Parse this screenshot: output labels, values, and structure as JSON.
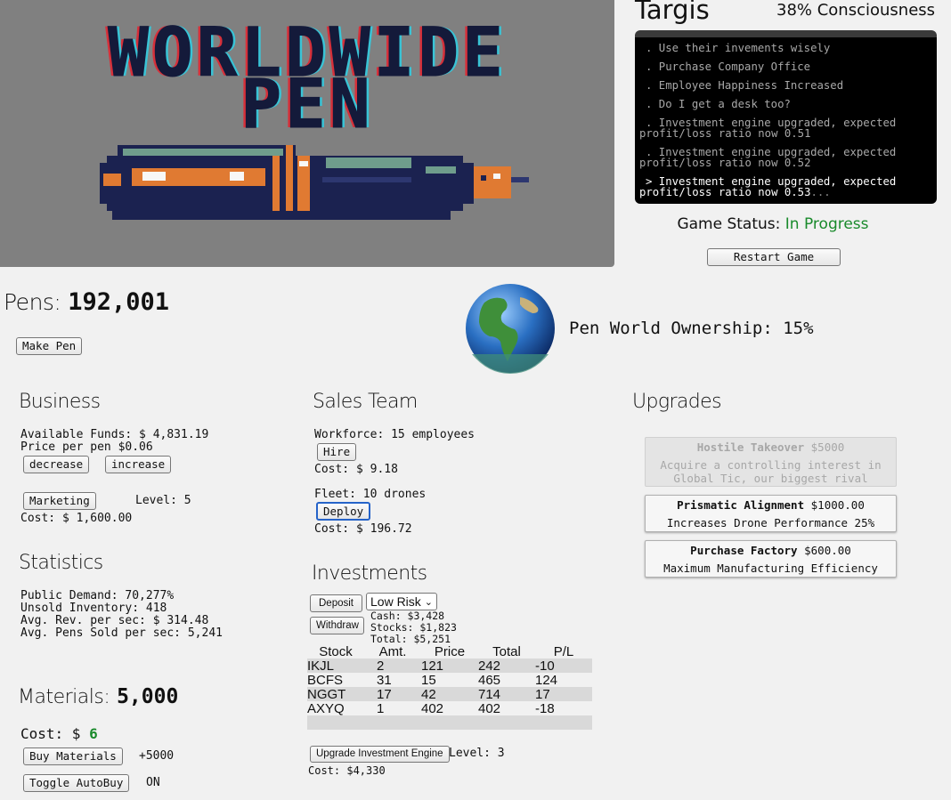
{
  "banner": {
    "line1": "WORLDWIDE",
    "line2": "PEN"
  },
  "console": {
    "title": "Targis",
    "consciousness": "38% Consciousness",
    "logs": [
      ". Use their invements wisely",
      ". Purchase Company Office",
      ". Employee Happiness Increased",
      ". Do I get a desk too?",
      ". Investment engine upgraded, expected profit/loss ratio now 0.51",
      ". Investment engine upgraded, expected profit/loss ratio now 0.52",
      "> Investment engine upgraded, expected profit/loss ratio now 0.53"
    ],
    "cursor": "...",
    "status_label": "Game Status:",
    "status_value": "In Progress",
    "restart_label": "Restart Game"
  },
  "pens": {
    "label": "Pens:",
    "count": "192,001",
    "make_label": "Make Pen"
  },
  "world": {
    "label": "Pen World Ownership: 15%"
  },
  "business": {
    "title": "Business",
    "funds": "Available Funds: $ 4,831.19",
    "price": "Price per pen $0.06",
    "decrease_label": "decrease",
    "increase_label": "increase",
    "marketing_label": "Marketing",
    "marketing_level": "Level: 5",
    "marketing_cost": "Cost: $ 1,600.00"
  },
  "statistics": {
    "title": "Statistics",
    "demand": "Public Demand: 70,277%",
    "unsold": "Unsold Inventory: 418",
    "avg_rev": "Avg. Rev. per sec: $ 314.48",
    "avg_sold": "Avg. Pens Sold per sec: 5,241"
  },
  "materials": {
    "label": "Materials:",
    "count": "5,000",
    "cost_label": "Cost: $",
    "cost_value": "6",
    "buy_label": "Buy Materials",
    "buy_amount": "+5000",
    "autobuy_label": "Toggle AutoBuy",
    "autobuy_state": "ON"
  },
  "sales": {
    "title": "Sales Team",
    "workforce": "Workforce: 15 employees",
    "hire_label": "Hire",
    "hire_cost": "Cost: $ 9.18",
    "fleet": "Fleet: 10 drones",
    "deploy_label": "Deploy",
    "deploy_cost": "Cost: $ 196.72"
  },
  "investments": {
    "title": "Investments",
    "deposit_label": "Deposit",
    "withdraw_label": "Withdraw",
    "risk_selected": "Low Risk",
    "cash": "Cash: $3,428",
    "stocks": "Stocks: $1,823",
    "total": "Total: $5,251",
    "headers": [
      "Stock",
      "Amt.",
      "Price",
      "Total",
      "P/L"
    ],
    "rows": [
      [
        "IKJL",
        "2",
        "121",
        "242",
        "-10"
      ],
      [
        "BCFS",
        "31",
        "15",
        "465",
        "124"
      ],
      [
        "NGGT",
        "17",
        "42",
        "714",
        "17"
      ],
      [
        "AXYQ",
        "1",
        "402",
        "402",
        "-18"
      ]
    ],
    "upgrade_label": "Upgrade Investment Engine",
    "upgrade_level": "Level: 3",
    "upgrade_cost": "Cost: $4,330"
  },
  "upgrades": {
    "title": "Upgrades",
    "items": [
      {
        "name": "Hostile Takeover",
        "price": "$5000",
        "desc": "Acquire a controlling interest in Global Tic, our biggest rival",
        "enabled": false
      },
      {
        "name": "Prismatic Alignment",
        "price": "$1000.00",
        "desc": "Increases Drone Performance 25%",
        "enabled": true
      },
      {
        "name": "Purchase Factory",
        "price": "$600.00",
        "desc": "Maximum Manufacturing Efficiency",
        "enabled": true
      }
    ]
  },
  "colors": {
    "banner_bg": "#808080",
    "status_green": "#198a2b",
    "console_bg": "#000000",
    "logo_cyan": "#39c4d6",
    "logo_red": "#d6303a",
    "logo_navy": "#141a3a",
    "pen_orange": "#e07a32"
  }
}
